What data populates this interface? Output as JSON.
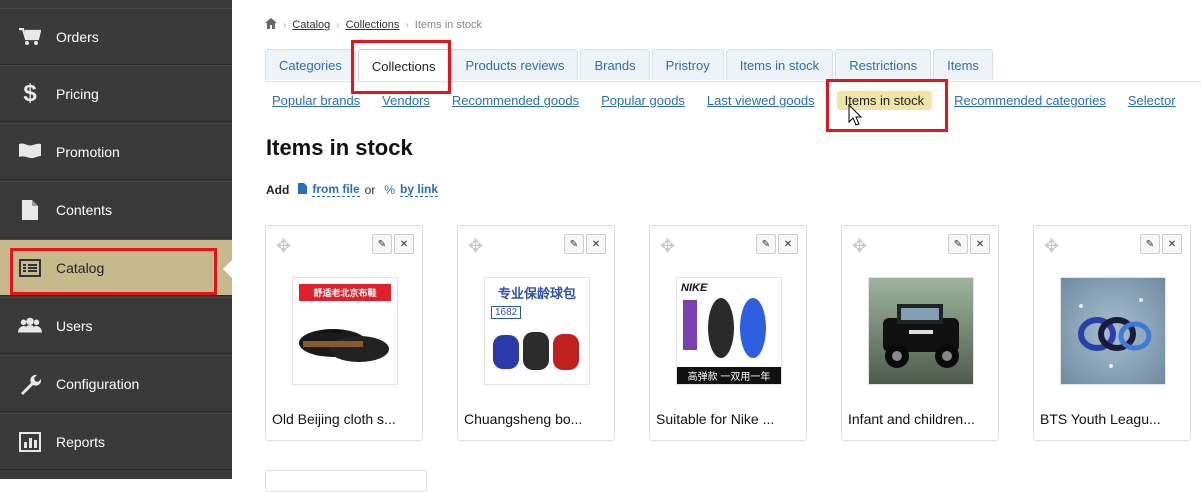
{
  "sidebar": {
    "items": [
      {
        "label": "Orders",
        "icon": "cart-icon"
      },
      {
        "label": "Pricing",
        "icon": "dollar-icon"
      },
      {
        "label": "Promotion",
        "icon": "flag-icon"
      },
      {
        "label": "Contents",
        "icon": "document-icon"
      },
      {
        "label": "Catalog",
        "icon": "list-icon",
        "active": true
      },
      {
        "label": "Users",
        "icon": "users-icon"
      },
      {
        "label": "Configuration",
        "icon": "wrench-icon"
      },
      {
        "label": "Reports",
        "icon": "chart-icon"
      }
    ]
  },
  "breadcrumb": {
    "home_icon": "home-icon",
    "items": [
      "Catalog",
      "Collections",
      "Items in stock"
    ]
  },
  "tabs": [
    "Categories",
    "Collections",
    "Products reviews",
    "Brands",
    "Pristroy",
    "Items in stock",
    "Restrictions",
    "Items"
  ],
  "active_tab": "Collections",
  "subnav": [
    "Popular brands",
    "Vendors",
    "Recommended goods",
    "Popular goods",
    "Last viewed goods",
    "Items in stock",
    "Recommended categories",
    "Selector"
  ],
  "active_subnav": "Items in stock",
  "page_title": "Items in stock",
  "add": {
    "label": "Add",
    "from_file": "from file",
    "or": "or",
    "by_link": "by link"
  },
  "products": [
    {
      "name": "Old Beijing cloth s...",
      "thumb_text": "舒适老北京布鞋"
    },
    {
      "name": "Chuangsheng bo...",
      "thumb_text": "专业保龄球包",
      "thumb_sub": "1682"
    },
    {
      "name": "Suitable for Nike ...",
      "thumb_text": "高弹款 一双用一年",
      "brand": "NIKE"
    },
    {
      "name": "Infant and children...",
      "thumb_text": ""
    },
    {
      "name": "BTS Youth Leagu...",
      "thumb_text": ""
    }
  ],
  "colors": {
    "highlight": "#e8121b",
    "sidebar": "#3a3a3a",
    "active_sidebar": "#c8b98c",
    "link": "#2a6ebb"
  }
}
